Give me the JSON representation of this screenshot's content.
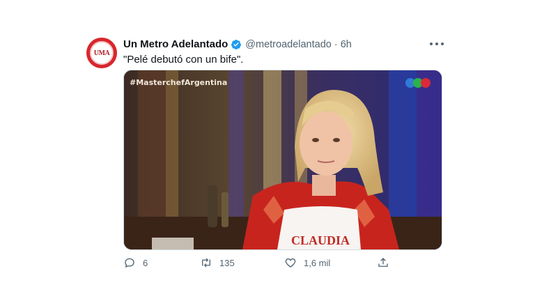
{
  "tweet": {
    "author_name": "Un Metro Adelantado",
    "handle": "@metroadelantado",
    "separator": "·",
    "time": "6h",
    "text": "\"Pelé debutó con un bife\".",
    "avatar_text": "UMA",
    "verified": true
  },
  "media": {
    "hashtag": "#MasterchefArgentina",
    "apron_text": "CLAUDIA",
    "logo_colors": [
      "#2f7bd6",
      "#2bb24c",
      "#d9293a"
    ]
  },
  "actions": {
    "replies": "6",
    "retweets": "135",
    "likes": "1,6 mil"
  },
  "colors": {
    "accent": "#1d9bf0",
    "text": "#0f1419",
    "secondary": "#536471",
    "avatar_bg": "#d8262c"
  },
  "icons": [
    "verified-badge-icon",
    "more-icon",
    "reply-icon",
    "retweet-icon",
    "like-icon",
    "share-icon"
  ]
}
